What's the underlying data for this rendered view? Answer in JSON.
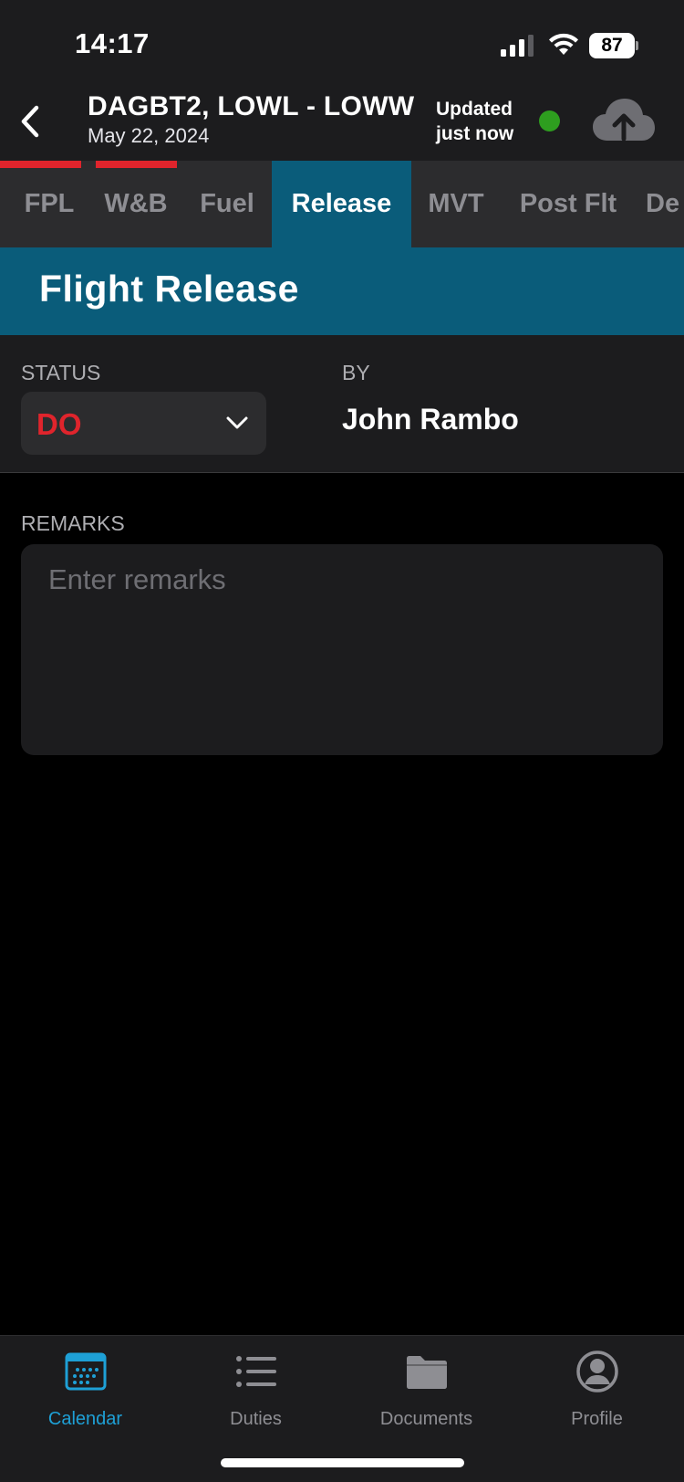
{
  "status_bar": {
    "time": "14:17",
    "battery": "87",
    "icons": [
      "cellular-signal-icon",
      "wifi-icon",
      "battery-icon"
    ]
  },
  "header": {
    "back_icon": "chevron-left-icon",
    "title": "DAGBT2, LOWL - LOWW",
    "subtitle": "May 22, 2024",
    "sync_status": "Updated just now",
    "sync_dot_color": "#2e9e1f",
    "upload_icon": "cloud-upload-icon"
  },
  "tabs": [
    {
      "label": "FPL",
      "flagged": true,
      "active": false
    },
    {
      "label": "W&B",
      "flagged": true,
      "active": false
    },
    {
      "label": "Fuel",
      "flagged": false,
      "active": false
    },
    {
      "label": "Release",
      "flagged": true,
      "active": true
    },
    {
      "label": "MVT",
      "flagged": false,
      "active": false
    },
    {
      "label": "Post Flt",
      "flagged": false,
      "active": false
    },
    {
      "label": "De",
      "flagged": false,
      "active": false
    }
  ],
  "section": {
    "title": "Flight Release"
  },
  "release": {
    "status_label": "STATUS",
    "status_value": "DO",
    "by_label": "BY",
    "by_value": "John Rambo",
    "remarks_label": "REMARKS",
    "remarks_placeholder": "Enter remarks",
    "remarks_value": ""
  },
  "bottom_nav": [
    {
      "label": "Calendar",
      "icon": "calendar-icon",
      "active": true
    },
    {
      "label": "Duties",
      "icon": "list-icon",
      "active": false
    },
    {
      "label": "Documents",
      "icon": "folder-icon",
      "active": false
    },
    {
      "label": "Profile",
      "icon": "profile-icon",
      "active": false
    }
  ],
  "colors": {
    "accent_blue": "#0a5c7a",
    "flag_red": "#e0242c",
    "nav_active": "#1ea0d6",
    "background": "#000000",
    "surface": "#1c1c1e"
  }
}
